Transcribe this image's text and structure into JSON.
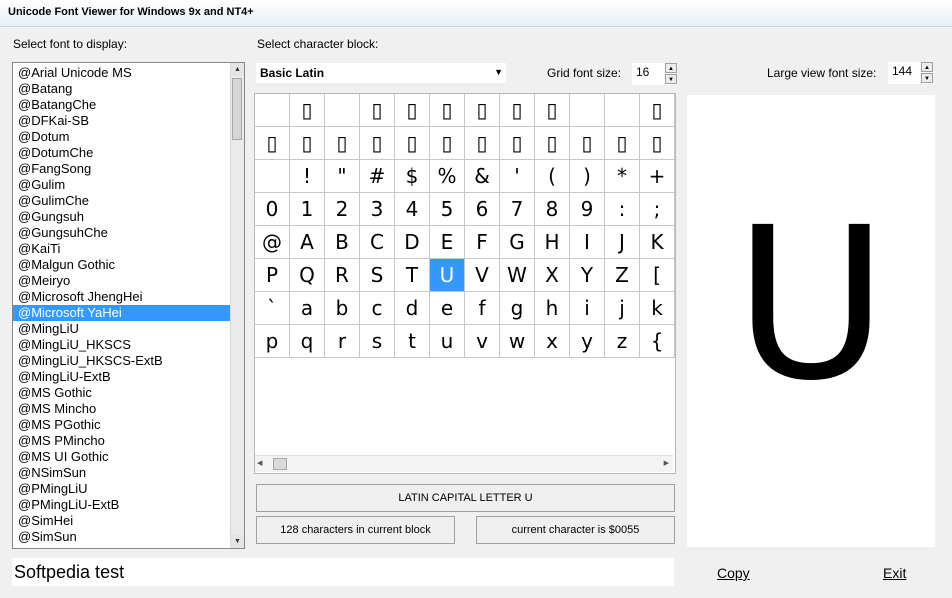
{
  "window": {
    "title": "Unicode Font Viewer for Windows 9x and NT4+"
  },
  "labels": {
    "select_font": "Select font to display:",
    "select_block": "Select character block:",
    "grid_font_size": "Grid font size:",
    "large_view_font_size": "Large view font size:"
  },
  "fonts": [
    "@Arial Unicode MS",
    "@Batang",
    "@BatangChe",
    "@DFKai-SB",
    "@Dotum",
    "@DotumChe",
    "@FangSong",
    "@Gulim",
    "@GulimChe",
    "@Gungsuh",
    "@GungsuhChe",
    "@KaiTi",
    "@Malgun Gothic",
    "@Meiryo",
    "@Microsoft JhengHei",
    "@Microsoft YaHei",
    "@MingLiU",
    "@MingLiU_HKSCS",
    "@MingLiU_HKSCS-ExtB",
    "@MingLiU-ExtB",
    "@MS Gothic",
    "@MS Mincho",
    "@MS PGothic",
    "@MS PMincho",
    "@MS UI Gothic",
    "@NSimSun",
    "@PMingLiU",
    "@PMingLiU-ExtB",
    "@SimHei",
    "@SimSun"
  ],
  "selected_font": "@Microsoft YaHei",
  "block_select": {
    "value": "Basic Latin"
  },
  "grid_font_size": "16",
  "large_font_size": "144",
  "grid": {
    "rows": [
      [
        "",
        "▯",
        "",
        "▯",
        "▯",
        "▯",
        "▯",
        "▯",
        "▯",
        "",
        "",
        "▯"
      ],
      [
        "▯",
        "▯",
        "▯",
        "▯",
        "▯",
        "▯",
        "▯",
        "▯",
        "▯",
        "▯",
        "▯",
        "▯"
      ],
      [
        "",
        "!",
        "\"",
        "#",
        "$",
        "%",
        "&",
        "'",
        "(",
        ")",
        "*",
        "+"
      ],
      [
        "0",
        "1",
        "2",
        "3",
        "4",
        "5",
        "6",
        "7",
        "8",
        "9",
        ":",
        ";"
      ],
      [
        "@",
        "A",
        "B",
        "C",
        "D",
        "E",
        "F",
        "G",
        "H",
        "I",
        "J",
        "K"
      ],
      [
        "P",
        "Q",
        "R",
        "S",
        "T",
        "U",
        "V",
        "W",
        "X",
        "Y",
        "Z",
        "["
      ],
      [
        "`",
        "a",
        "b",
        "c",
        "d",
        "e",
        "f",
        "g",
        "h",
        "i",
        "j",
        "k"
      ],
      [
        "p",
        "q",
        "r",
        "s",
        "t",
        "u",
        "v",
        "w",
        "x",
        "y",
        "z",
        "{"
      ]
    ],
    "selected": "U"
  },
  "char_name": "LATIN CAPITAL LETTER U",
  "char_count": "128 characters in current block",
  "current_char": "current character is $0055",
  "large_char": "U",
  "test_text": "Softpedia test",
  "buttons": {
    "copy": "Copy",
    "exit": "Exit"
  }
}
